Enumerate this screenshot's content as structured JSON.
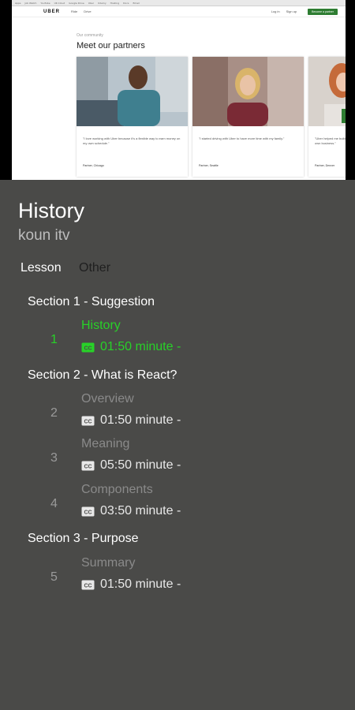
{
  "video_preview": {
    "bookmarks": [
      "Apps",
      "Job Watch",
      "YouTube",
      "UK Cloud",
      "Google Drive",
      "Uber",
      "Udemy",
      "Hosting",
      "Docs",
      "Email"
    ],
    "site": {
      "logo": "UBER",
      "nav": [
        "Ride",
        "Drive"
      ],
      "right_links": [
        "Log in",
        "Sign up"
      ],
      "cta": "Become a partner",
      "kicker": "Our community",
      "heading": "Meet our partners",
      "cards": [
        {
          "quote": "\"I love working with Uber because it's a flexible way to earn money on my own schedule.\"",
          "byline": "Partner, Chicago"
        },
        {
          "quote": "\"I started driving with Uber to have more time with my family.\"",
          "byline": "Partner, Seattle"
        },
        {
          "quote": "\"Uber helped me build my own business.\"",
          "byline": "Partner, Denver"
        }
      ],
      "next_arrow": "→"
    }
  },
  "header": {
    "title": "History",
    "subtitle": "koun itv"
  },
  "tabs": [
    {
      "label": "Lesson",
      "active": true
    },
    {
      "label": "Other",
      "active": false
    }
  ],
  "sections": [
    {
      "title": "Section 1 - Suggestion",
      "lessons": [
        {
          "number": "1",
          "name": "History",
          "duration": "01:50 minute -",
          "active": true
        }
      ]
    },
    {
      "title": "Section 2 - What is React?",
      "lessons": [
        {
          "number": "2",
          "name": "Overview",
          "duration": "01:50 minute -",
          "active": false
        },
        {
          "number": "3",
          "name": "Meaning",
          "duration": "05:50 minute -",
          "active": false
        },
        {
          "number": "4",
          "name": "Components",
          "duration": "03:50 minute -",
          "active": false
        }
      ]
    },
    {
      "title": "Section 3 - Purpose",
      "lessons": [
        {
          "number": "5",
          "name": "Summary",
          "duration": "01:50 minute -",
          "active": false
        }
      ]
    }
  ],
  "colors": {
    "background": "#4a4a48",
    "accent": "#28d128",
    "inactive_text": "#8a8a8a"
  }
}
